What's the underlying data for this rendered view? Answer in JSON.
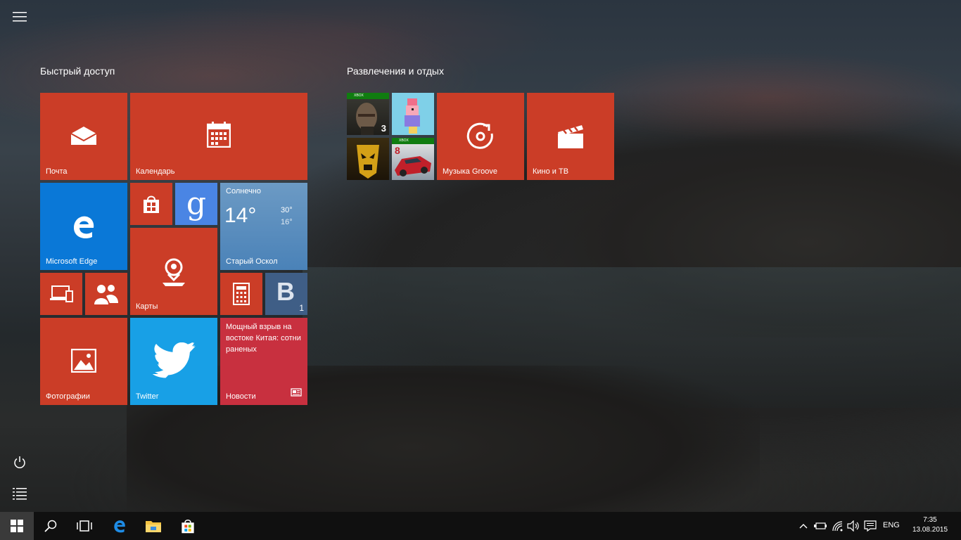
{
  "start_menu": {
    "groups": [
      {
        "title": "Быстрый доступ"
      },
      {
        "title": "Развлечения и отдых"
      }
    ],
    "tiles": {
      "mail": {
        "label": "Почта",
        "icon": "mail-icon"
      },
      "calendar": {
        "label": "Календарь",
        "icon": "calendar-icon"
      },
      "edge": {
        "label": "Microsoft Edge",
        "icon": "edge-icon"
      },
      "store": {
        "icon": "store-icon"
      },
      "google": {
        "icon": "google-icon"
      },
      "weather": {
        "condition": "Солнечно",
        "temp": "14°",
        "high": "30°",
        "low": "16°",
        "city": "Старый Оскол"
      },
      "maps": {
        "label": "Карты",
        "icon": "maps-icon"
      },
      "devices": {
        "icon": "devices-icon"
      },
      "people": {
        "icon": "people-icon"
      },
      "calculator": {
        "icon": "calculator-icon"
      },
      "vk": {
        "letter": "В",
        "badge": "1"
      },
      "photos": {
        "label": "Фотографии",
        "icon": "photos-icon"
      },
      "twitter": {
        "label": "Twitter",
        "icon": "twitter-icon"
      },
      "news": {
        "headline": "Мощный взрыв на востоке Китая: сотни раненых",
        "label": "Новости"
      },
      "game1": {
        "badge": "XBOX",
        "number": "3"
      },
      "game2": {
        "icon": "crossy-road-game"
      },
      "game3": {
        "icon": "shadow-game"
      },
      "game4": {
        "badge": "XBOX",
        "number": "8"
      },
      "groove": {
        "label": "Музыка Groove",
        "icon": "groove-icon"
      },
      "movies": {
        "label": "Кино и ТВ",
        "icon": "clapperboard-icon"
      }
    }
  },
  "taskbar": {
    "language": "ENG",
    "time": "7:35",
    "date": "13.08.2015"
  },
  "colors": {
    "tile_red": "#cb3d27",
    "tile_blue": "#0a78d7",
    "twitter_blue": "#18a0e6",
    "news_red": "#c8303f",
    "xbox_green": "#107c10"
  }
}
